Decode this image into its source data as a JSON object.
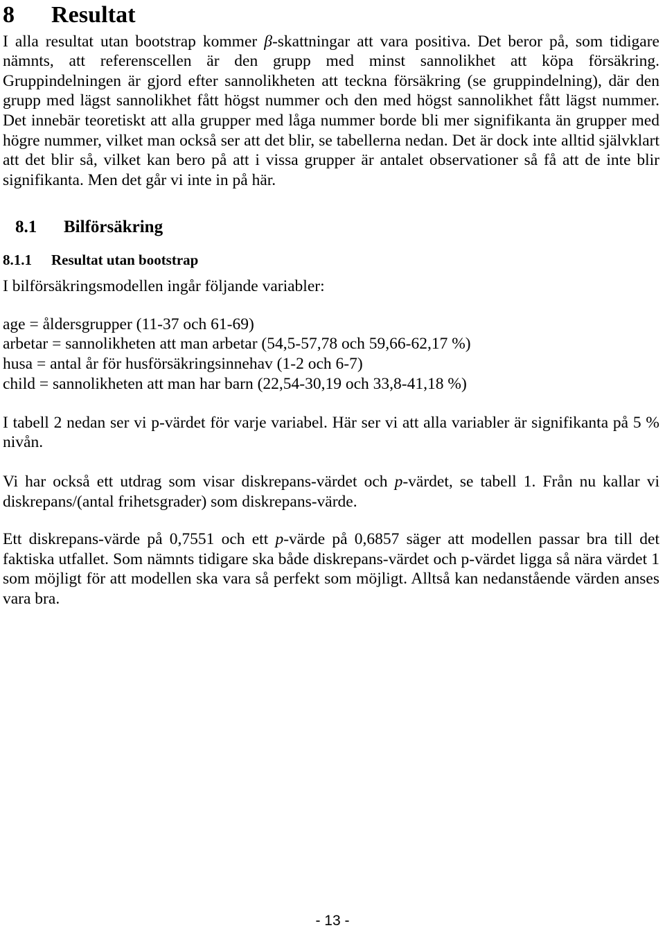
{
  "document": {
    "language": "sv",
    "page_number_label": "- 13 -"
  },
  "section": {
    "number": "8",
    "title": "Resultat"
  },
  "intro_paragraph": {
    "part1": "I alla resultat utan bootstrap kommer ",
    "symbol": "β",
    "part2": "-skattningar att vara positiva. Det beror på, som tidigare nämnts, att referenscellen är den grupp med minst sannolikhet att köpa försäkring. Gruppindelningen är gjord efter sannolikheten att teckna försäkring (se gruppindelning), där den grupp med lägst sannolikhet fått högst nummer och den med högst sannolikhet fått lägst nummer. Det innebär teoretiskt att alla grupper med låga nummer borde bli mer signifikanta än grupper med högre nummer, vilket man också ser att det blir, se tabellerna nedan. Det är dock inte alltid självklart att det blir så, vilket kan bero på att i vissa grupper är antalet observationer så få att de inte blir signifikanta. Men det går vi inte in på här."
  },
  "subsection": {
    "number": "8.1",
    "title": "Bilförsäkring"
  },
  "subsubsection": {
    "number": "8.1.1",
    "title": "Resultat utan bootstrap"
  },
  "variables_intro": "I bilförsäkringsmodellen ingår följande variabler:",
  "variables": [
    "age = åldersgrupper (11-37 och 61-69)",
    "arbetar = sannolikheten att man arbetar (54,5-57,78 och 59,66-62,17 %)",
    "husa = antal år för husförsäkringsinnehav (1-2 och 6-7)",
    "child = sannolikheten att man har barn (22,54-30,19 och 33,8-41,18 %)"
  ],
  "paragraph_table2": "I tabell 2 nedan ser vi p-värdet för varje variabel. Här ser vi att alla variabler är signifikanta på 5 % nivån.",
  "paragraph_discrepancy": {
    "part1": "Vi har också ett utdrag som visar diskrepans-värdet och ",
    "symbol": "p",
    "part2": "-värdet, se tabell 1. Från nu kallar vi diskrepans/(antal frihetsgrader) som diskrepans-värde."
  },
  "paragraph_values": {
    "part1": "Ett diskrepans-värde på 0,7551 och ett ",
    "symbol": "p",
    "part2": "-värde på 0,6857 säger att modellen passar bra till det faktiska utfallet. Som nämnts tidigare ska både diskrepans-värdet och p-värdet ligga så nära värdet 1 som möjligt för att modellen ska vara så perfekt som möjligt. Alltså kan nedanstående värden anses vara bra.",
    "discrepancy_value": "0,7551",
    "p_value": "0,6857"
  }
}
